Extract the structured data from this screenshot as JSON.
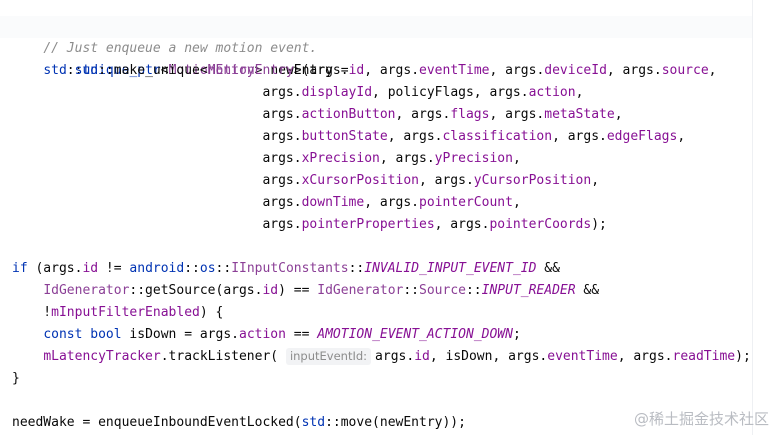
{
  "code": {
    "l1": "// Just enqueue a new motion event.",
    "l2": "newEntry =",
    "l3_tail": "(args.",
    "hint": "inputEventId:",
    "watermark": "@稀土掘金技术社区"
  }
}
